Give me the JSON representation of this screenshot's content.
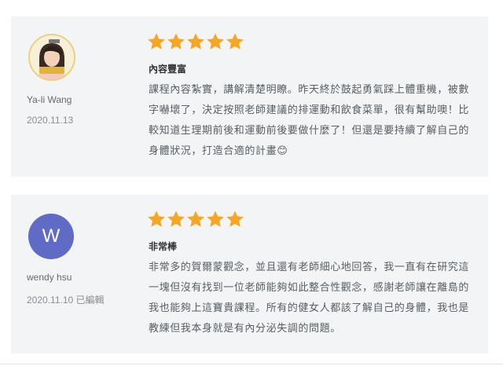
{
  "reviews": [
    {
      "name": "Ya-li Wang",
      "date": "2020.11.13",
      "rating": 5,
      "title": "內容豐富",
      "body": "課程內容紮實，講解清楚明瞭。昨天終於鼓起勇氣踩上體重機，被數字嚇壞了，決定按照老師建議的排運動和飲食菜單，很有幫助噢！比較知道生理期前後和運動前後要做什麼了！但還是要持續了解自己的身體狀況，打造合適的計畫😊"
    },
    {
      "name": "wendy hsu",
      "date": "2020.11.10 已編輯",
      "rating": 5,
      "avatar_letter": "W",
      "title": "非常棒",
      "body": "非常多的賀爾蒙觀念，並且還有老師細心地回答，我一直有在研究這一塊但沒有找到一位老師能夠如此整合性觀念，感謝老師讓在離島的我也能夠上這寶貴課程。所有的健女人都該了解自己的身體，我也是教練但我本身就是有內分泌失調的問題。"
    }
  ],
  "colors": {
    "star": "#f5a623",
    "avatar2": "#5f6bc4",
    "card_bg": "#f2f4f5"
  }
}
